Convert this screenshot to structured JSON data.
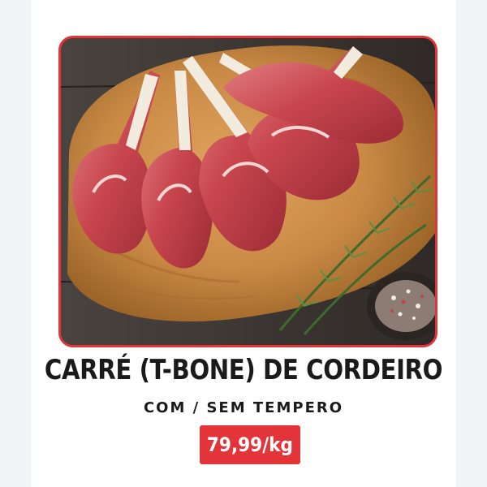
{
  "product": {
    "name": "CARRÉ (T-BONE) DE CORDEIRO",
    "variant": "COM / SEM TEMPERO",
    "price": "79,99/kg",
    "image_icon": "lamb-rack-photo"
  },
  "colors": {
    "accent": "#e3343a",
    "text": "#1a1a1a",
    "price_text": "#ffffff"
  }
}
